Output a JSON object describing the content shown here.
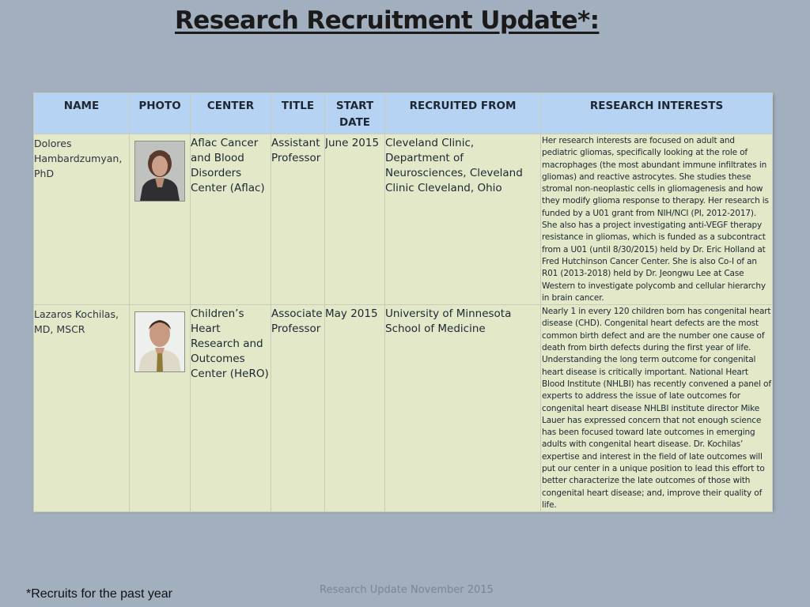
{
  "title": "Research Recruitment Update*:",
  "table": {
    "headers": [
      "NAME",
      "PHOTO",
      "CENTER",
      "TITLE",
      "START DATE",
      "RECRUITED FROM",
      "RESEARCH INTERESTS"
    ],
    "rows": [
      {
        "name": "Dolores Hambardzumyan, PhD",
        "photo": "portrait-woman",
        "center": "Aflac Cancer and Blood Disorders Center (Aflac)",
        "title": "Assistant Professor",
        "start_date": "June 2015",
        "recruited_from": "Cleveland Clinic, Department of Neurosciences, Cleveland Clinic Cleveland, Ohio",
        "research_interests": "Her research interests are focused on adult and pediatric gliomas, specifically looking at the role of macrophages (the most abundant immune infiltrates in gliomas) and reactive astrocytes. She studies these stromal non-neoplastic cells in gliomagenesis and how they modify glioma response to therapy. Her research is funded by a U01 grant from NIH/NCI (PI, 2012-2017). She also has a project investigating anti-VEGF therapy resistance in gliomas, which is funded as a subcontract from a U01 (until 8/30/2015) held by Dr. Eric Holland at Fred Hutchinson Cancer Center. She is also Co-I of an R01 (2013-2018) held by Dr. Jeongwu Lee at Case Western to investigate polycomb and cellular hierarchy in brain cancer."
      },
      {
        "name": "Lazaros Kochilas, MD, MSCR",
        "photo": "portrait-man",
        "center": "Children’s Heart Research and Outcomes Center (HeRO)",
        "title": "Associate Professor",
        "start_date": "May 2015",
        "recruited_from": "University of Minnesota School of Medicine",
        "research_interests": "Nearly 1 in every 120 children born has congenital heart disease (CHD). Congenital heart defects are the most common birth defect and are the number one cause of death from birth defects during the first year of life. Understanding the long term outcome for congenital heart disease is critically important. National Heart Blood Institute (NHLBI) has recently convened a panel of experts to address the issue of late outcomes for congenital heart disease NHLBI institute director Mike Lauer has expressed concern that not enough science has been focused toward late outcomes in emerging adults with congenital heart disease. Dr. Kochilas’ expertise and interest in the field of late outcomes will put our center in a unique position to lead this effort to better characterize the late outcomes of those with congenital heart disease; and, improve their quality of life."
      }
    ]
  },
  "footnote": "*Recruits for the past year",
  "footer": "Research Update November 2015",
  "colors": {
    "background": "#a2afbf",
    "header_fill": "#b6d3f3",
    "row_fill": "#e3e8c9"
  }
}
